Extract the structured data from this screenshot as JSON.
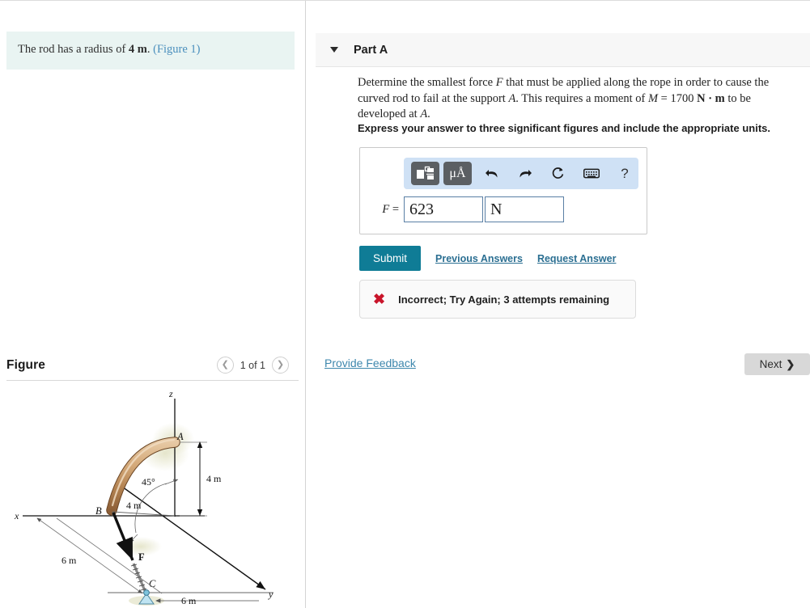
{
  "statement": {
    "text_before": "The rod has a radius of ",
    "radius_value": "4 m",
    "text_after": ".",
    "figure_link": "(Figure 1)"
  },
  "figure_panel": {
    "title": "Figure",
    "pager_prev_icon": "chevron-left-icon",
    "pager_next_icon": "chevron-right-icon",
    "pager_label": "1 of 1"
  },
  "part": {
    "caret_icon": "caret-down-icon",
    "title": "Part A",
    "question_p1_a": "Determine the smallest force ",
    "question_F": "F",
    "question_p1_b": " that must be applied along the rope in order to cause the curved rod to fail at the support ",
    "question_A1": "A",
    "question_p1_c": ". This requires a moment of ",
    "question_M": "M",
    "question_eq": " = 1700 ",
    "question_units": "N · m",
    "question_p1_d": " to be developed at ",
    "question_A2": "A",
    "question_p1_e": ".",
    "instruction": "Express your answer to three significant figures and include the appropriate units."
  },
  "toolbar": {
    "template_icon": "math-template-icon",
    "units_icon": "micro-angstrom-units-icon",
    "units_label": "μÅ",
    "undo_icon": "undo-arrow-icon",
    "redo_icon": "redo-arrow-icon",
    "reset_icon": "reset-circular-arrow-icon",
    "keyboard_icon": "keyboard-icon",
    "help_icon": "question-mark-icon",
    "help_label": "?"
  },
  "answer": {
    "label_var": "F",
    "label_eq": "=",
    "value": "623",
    "value_placeholder": "",
    "unit": "N",
    "unit_placeholder": ""
  },
  "actions": {
    "submit_label": "Submit",
    "previous_answers_label": "Previous Answers",
    "request_answer_label": "Request Answer"
  },
  "feedback": {
    "icon": "red-x-icon",
    "message": "Incorrect; Try Again; 3 attempts remaining"
  },
  "footer": {
    "provide_feedback_label": "Provide Feedback",
    "next_label": "Next",
    "next_chevron_icon": "chevron-right-icon"
  },
  "colors": {
    "submit_teal": "#0f7c96",
    "statement_bg": "#e9f4f2",
    "toolbar_blue": "#cfe1f5",
    "error_red": "#c9152b",
    "link_blue": "#2b6f92",
    "rod_tan": "#c89a6a",
    "support_blue": "#7fc4dd"
  },
  "diagram": {
    "labels": {
      "axis_z": "z",
      "axis_x": "x",
      "axis_y": "y",
      "point_A": "A",
      "point_B": "B",
      "point_C": "C",
      "force_F": "F",
      "angle": "45°",
      "dim_radius": "4 m",
      "dim_height": "4 m",
      "dim_x": "6 m",
      "dim_y": "6 m"
    }
  }
}
